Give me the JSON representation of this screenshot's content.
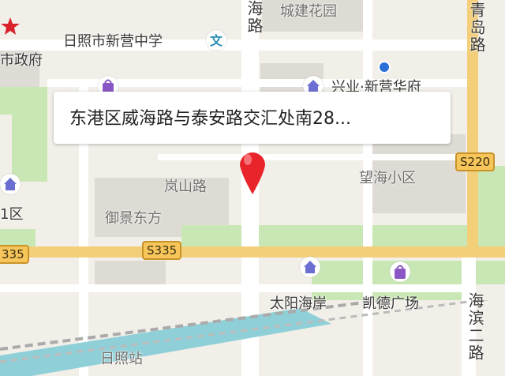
{
  "map": {
    "selected_address": "东港区威海路与泰安路交汇处南28...",
    "labels": {
      "school": "日照市新营中学",
      "gov": "市政府",
      "garden": "城建花园",
      "xingye": "兴业·新营华府",
      "district1": "1区",
      "lanshan": "岚山路",
      "yujing": "御景东方",
      "wanghai": "望海小区",
      "taiyang": "太阳海岸",
      "kaide": "凯德广场",
      "station": "日照站",
      "partial_road_top": "海路",
      "qingdao_road": "青岛路",
      "haibin_road": "海滨二路"
    },
    "shields": {
      "s220": "S220",
      "s335_left": "335",
      "s335_main": "S335"
    },
    "icons": {
      "pin": "map-pin-icon",
      "location_dot": "location-dot-icon",
      "school_poi": "culture-icon",
      "gov_poi": "government-star-icon",
      "home_poi": "home-icon",
      "shopping_poi": "shopping-bag-icon",
      "train": "railway-icon"
    },
    "colors": {
      "background": "#f2efe9",
      "green": "#c9e7b4",
      "building": "#dedbd5",
      "highway": "#f3cf7a",
      "water": "#8fd0d8",
      "pin": "#e8242a",
      "location_dot": "#2b6fd8",
      "poi_blue": "#6b6fd1",
      "poi_purple": "#8a58c4",
      "gov_red": "#d9232b"
    }
  }
}
